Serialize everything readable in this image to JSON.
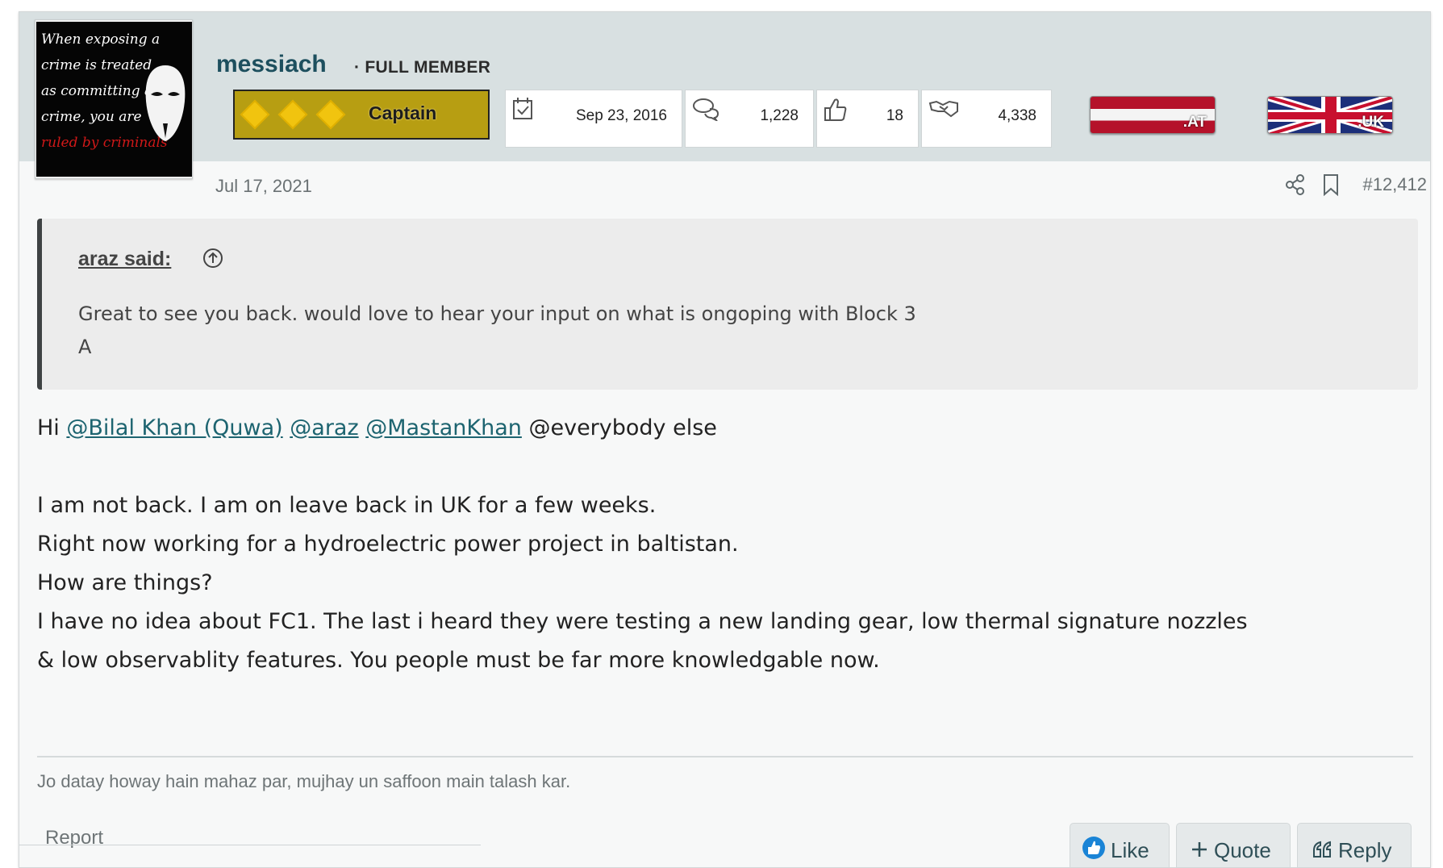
{
  "user": {
    "username": "messiach",
    "member_title": "· FULL MEMBER",
    "avatar_text": [
      "When exposing a",
      "crime is treated",
      "as committing a",
      "crime, you are",
      "ruled by criminals"
    ],
    "rank_label": "Captain"
  },
  "stats": {
    "joined": "Sep 23, 2016",
    "messages": "1,228",
    "reactions": "18",
    "points": "4,338"
  },
  "flags": [
    {
      "code": ".AT",
      "icon": "austria-flag-icon"
    },
    {
      "code": ".UK",
      "icon": "uk-flag-icon"
    }
  ],
  "post": {
    "date": "Jul 17, 2021",
    "number": "#12,412"
  },
  "quote": {
    "author": "araz said:",
    "text_line1": "Great to see you back. would love to hear your input on what is ongoping with Block 3",
    "text_line2": "A"
  },
  "body": {
    "greeting": "Hi",
    "mentions": [
      "@Bilal Khan (Quwa)",
      "@araz",
      "@MastanKhan"
    ],
    "mention_tail": "@everybody else",
    "lines": [
      "I am not back. I am on leave back in UK for a few weeks.",
      "Right now working for a hydroelectric power project in baltistan.",
      "How are things?",
      "I have no idea about FC1. The last i heard they were testing a new landing gear, low thermal signature nozzles",
      "& low observablity features. You people must be far more knowledgable now."
    ]
  },
  "signature": "Jo datay howay hain mahaz par, mujhay un saffoon main talash kar.",
  "footer": {
    "report": "Report",
    "like": "Like",
    "quote": "Quote",
    "reply": "Reply"
  },
  "colors": {
    "header_band": "#d8e0e1",
    "username": "#1d4f5e",
    "link": "#1d6470",
    "rank_gold": "#b79e12"
  }
}
